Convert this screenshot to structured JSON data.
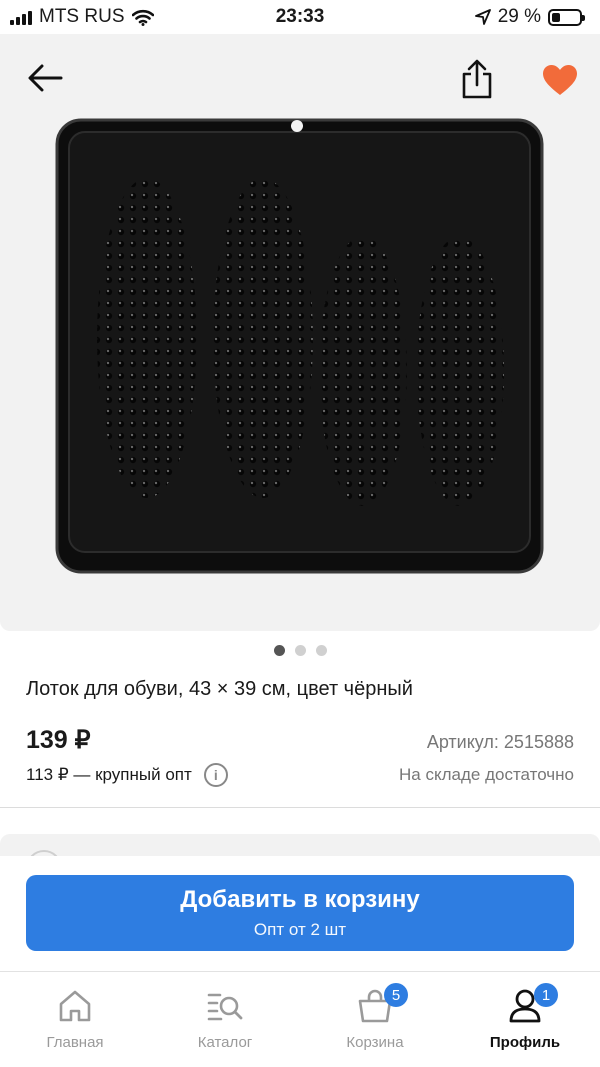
{
  "status_bar": {
    "carrier": "MTS RUS",
    "time": "23:33",
    "battery": "29 %",
    "battery_level": 0.29
  },
  "header": {
    "back_icon": "arrow-left-icon",
    "share_icon": "share-icon",
    "favorite_icon": "heart-icon",
    "favorite_color": "#f26b3a"
  },
  "gallery": {
    "image": "black-shoe-tray",
    "total_images": 3,
    "active_index": 0
  },
  "product": {
    "title": "Лоток для обуви, 43 × 39 см, цвет чёрный",
    "price": "139 ₽",
    "article": "Артикул: 2515888",
    "wholesale": "113 ₽ — крупный опт",
    "stock": "На складе достаточно"
  },
  "cta": {
    "title": "Добавить в корзину",
    "subtitle": "Опт от 2 шт",
    "color": "#2e7de1"
  },
  "tabbar": {
    "items": [
      {
        "label": "Главная",
        "icon": "home-icon"
      },
      {
        "label": "Каталог",
        "icon": "catalog-search-icon"
      },
      {
        "label": "Корзина",
        "icon": "cart-bag-icon",
        "badge": "5"
      },
      {
        "label": "Профиль",
        "icon": "profile-icon",
        "badge": "1",
        "active": true
      }
    ]
  }
}
